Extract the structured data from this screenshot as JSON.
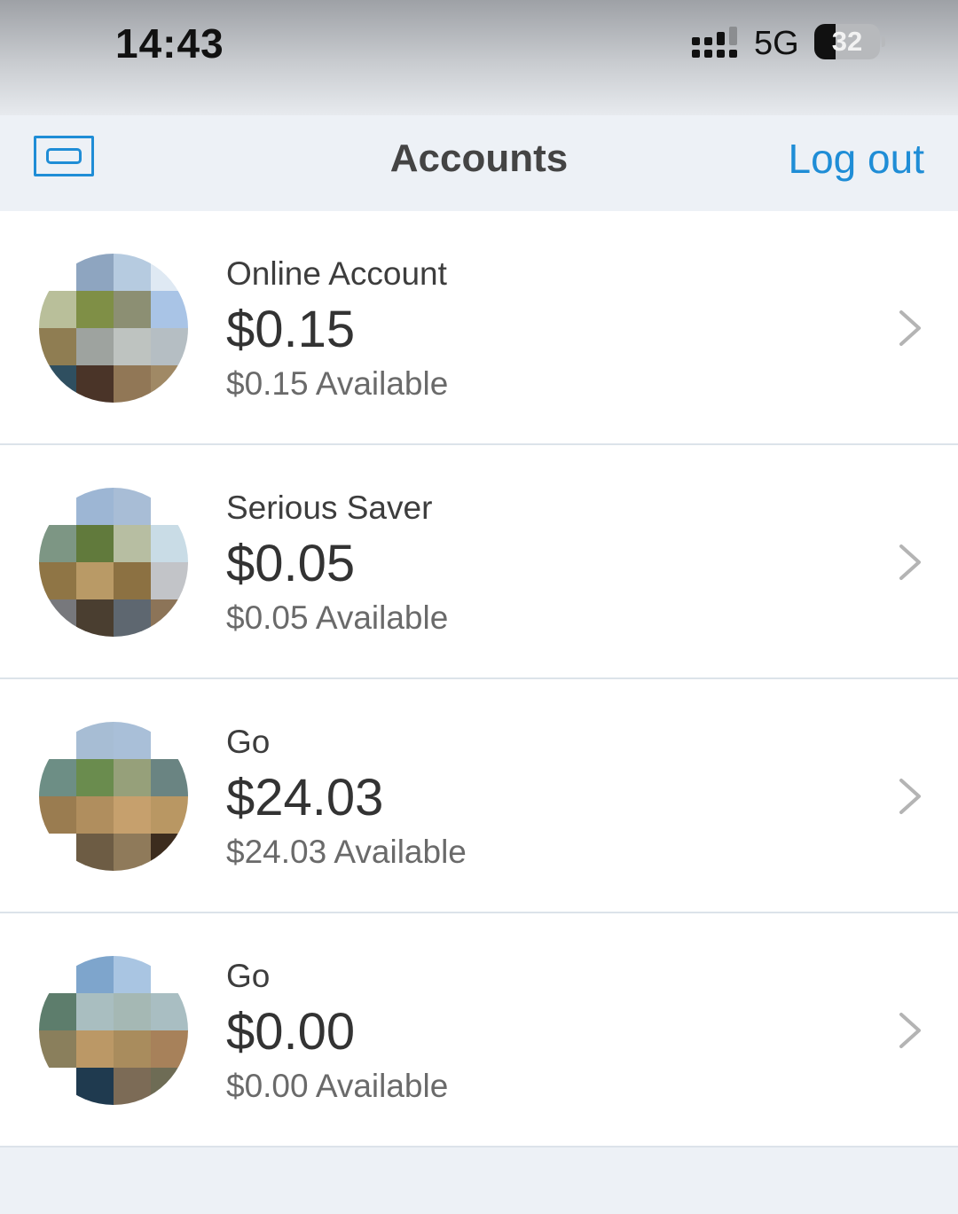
{
  "status_bar": {
    "time": "14:43",
    "network": "5G",
    "battery": "32",
    "battery_level": 0.32,
    "icons": [
      "signal-icon",
      "battery-icon"
    ]
  },
  "nav": {
    "menu_icon": "card-menu-icon",
    "title": "Accounts",
    "logout_label": "Log out"
  },
  "colors": {
    "accent": "#1f8dd6",
    "background": "#edf1f6",
    "row_background": "#ffffff",
    "divider": "#dce3ea"
  },
  "accounts": [
    {
      "name": "Online Account",
      "balance": "$0.15",
      "available": "$0.15 Available",
      "avatar": [
        "#ffffff",
        "#8ea5c0",
        "#b6cbe0",
        "#dfe9f3",
        "#b9bf9a",
        "#7f8f46",
        "#8c8f73",
        "#a9c4e6",
        "#8f7d52",
        "#9ea39f",
        "#bec3c0",
        "#b5bec3",
        "#2f4f60",
        "#4a3428",
        "#917756",
        "#a08965"
      ]
    },
    {
      "name": "Serious Saver",
      "balance": "$0.05",
      "available": "$0.05 Available",
      "avatar": [
        "#ffffff",
        "#9db6d4",
        "#a8bdd6",
        "#ffffff",
        "#7d9684",
        "#617a3c",
        "#b7bea2",
        "#c9dce6",
        "#8f7545",
        "#b99a66",
        "#8c7142",
        "#c2c4c8",
        "#77787c",
        "#4a3e30",
        "#5e6770",
        "#8c7458"
      ]
    },
    {
      "name": "Go",
      "balance": "$24.03",
      "available": "$24.03 Available",
      "avatar": [
        "#ffffff",
        "#a7bdd4",
        "#a9bfd8",
        "#ffffff",
        "#6d8e85",
        "#6a8c4e",
        "#96a07a",
        "#6a8482",
        "#9a7c50",
        "#b08e5e",
        "#c6a06d",
        "#b99763",
        "#ffffff",
        "#6d5c44",
        "#8f7a5a",
        "#3c2c1e"
      ]
    },
    {
      "name": "Go",
      "balance": "$0.00",
      "available": "$0.00 Available",
      "avatar": [
        "#ffffff",
        "#7ea5cc",
        "#a9c5e2",
        "#ffffff",
        "#5d7d6c",
        "#a9bec0",
        "#a5b8b4",
        "#a9bec2",
        "#8a7f5c",
        "#bb9866",
        "#a98c5d",
        "#a7815a",
        "#ffffff",
        "#1f3a4f",
        "#7c6b56",
        "#6e6c55"
      ]
    }
  ]
}
